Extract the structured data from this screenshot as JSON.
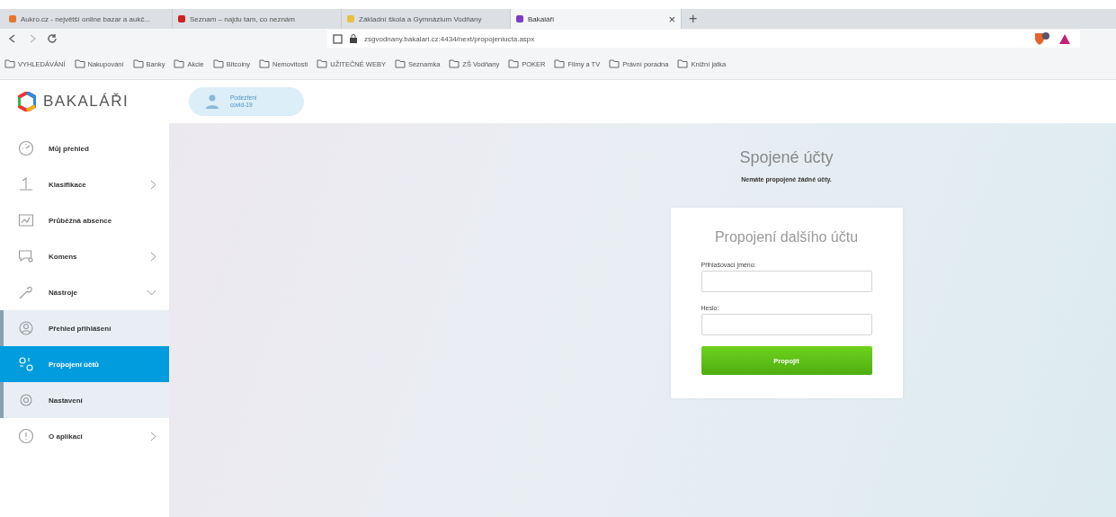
{
  "browser": {
    "tabs": [
      {
        "label": "Aukro.cz - největší online bazar a aukč...",
        "selected": false,
        "color": "#e8762c"
      },
      {
        "label": "Seznam – najdu tam, co neznám",
        "selected": false,
        "color": "#cc2222"
      },
      {
        "label": "Základní škola a Gymnázium Vodňany",
        "selected": false,
        "color": "#e8c040"
      },
      {
        "label": "Bakaláři",
        "selected": true,
        "color": "#7a3fc0"
      }
    ],
    "close_tab": "×",
    "new_tab": "+",
    "url": "zsgvodnany.bakalari.cz:4434/next/propojeniucta.aspx",
    "bookmarks": [
      "VYHLEDÁVÁNÍ",
      "Nakupování",
      "Banky",
      "Akcie",
      "Bitcoiny",
      "Nemovitosti",
      "UŽITEČNÉ WEBY",
      "Seznamka",
      "ZŠ Vodňany",
      "POKER",
      "Filmy a TV",
      "Právní poradna",
      "Knižní jatka"
    ]
  },
  "app": {
    "logo": "BAKALÁŘI",
    "header_badge": [
      "Podezření",
      "covid-19"
    ],
    "sidebar": [
      {
        "label": "Můj přehled",
        "kind": "link",
        "selected": false
      },
      {
        "label": "Klasifikace",
        "kind": "submenu",
        "selected": false
      },
      {
        "label": "Průběžná absence",
        "kind": "link",
        "selected": false
      },
      {
        "label": "Komens",
        "kind": "submenu",
        "selected": false
      },
      {
        "label": "Nástroje",
        "kind": "group",
        "selected": false,
        "expanded": true,
        "children": [
          {
            "label": "Přehled přihlášení",
            "selected": false
          },
          {
            "label": "Propojení účtů",
            "selected": true
          },
          {
            "label": "Nastavení",
            "selected": false
          }
        ]
      },
      {
        "label": "O aplikaci",
        "kind": "submenu",
        "selected": false
      }
    ],
    "main": {
      "title": "Spojené účty",
      "subtitle": "Nemáte propojené žádné účty.",
      "card": {
        "title": "Propojení dalšího účtu",
        "fields": [
          {
            "label": "Přihlašovací jméno:"
          },
          {
            "label": "Heslo:"
          }
        ],
        "button": "Propojit"
      }
    }
  }
}
